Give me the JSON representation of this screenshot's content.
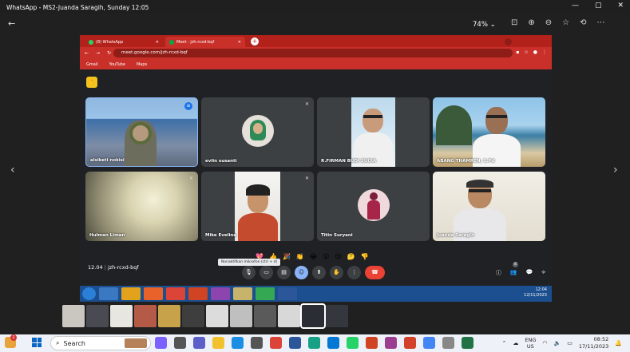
{
  "viewer": {
    "title": "WhatsApp - MS2-Juanda Saragih, Sunday 12:05",
    "zoom": "74%",
    "zoom_caret": "⌄",
    "prev_arrow": "‹",
    "next_arrow": "›",
    "back_arrow": "←"
  },
  "browser": {
    "tabs": [
      {
        "label": "(8) WhatsApp",
        "color": "#25d366"
      },
      {
        "label": "Meet - jzh-rcxd-bqf",
        "color": "#00ac47"
      }
    ],
    "url": "meet.google.com/jzh-rcxd-bqf",
    "bookmarks": [
      "Gmail",
      "YouTube",
      "Maps"
    ]
  },
  "meet": {
    "participants": [
      {
        "name": "alsiketi nokisi",
        "muted": false
      },
      {
        "name": "evlin susanti",
        "muted": true
      },
      {
        "name": "R.FIRMAN BUDI SUGIA",
        "muted": false
      },
      {
        "name": "ABANG THAMREN, S.Pd",
        "muted": false
      },
      {
        "name": "Hulman Liman",
        "muted": true
      },
      {
        "name": "Mike Evelina",
        "muted": true
      },
      {
        "name": "Titin Suryani",
        "muted": false
      },
      {
        "name": "Juanda Saragih",
        "muted": false
      }
    ],
    "time": "12.04",
    "code": "jzh-rcxd-bqf",
    "separator": "|",
    "tooltip": "Nonaktifkan mikrofon (ctrl + d)",
    "reactions": [
      "💖",
      "👍",
      "🎉",
      "👏",
      "😂",
      "😮",
      "😢",
      "🤔",
      "👎"
    ],
    "people_count": "8"
  },
  "inner_taskbar": {
    "time": "12:04",
    "date": "12/11/2023"
  },
  "taskbar": {
    "search_placeholder": "Search",
    "lang_top": "ENG",
    "lang_bottom": "US",
    "time": "08:52",
    "date": "17/11/2023",
    "notification_count": "1"
  },
  "colors": {
    "browser_red": "#c9302a",
    "meet_bg": "#202124",
    "end_call": "#ea4335"
  }
}
